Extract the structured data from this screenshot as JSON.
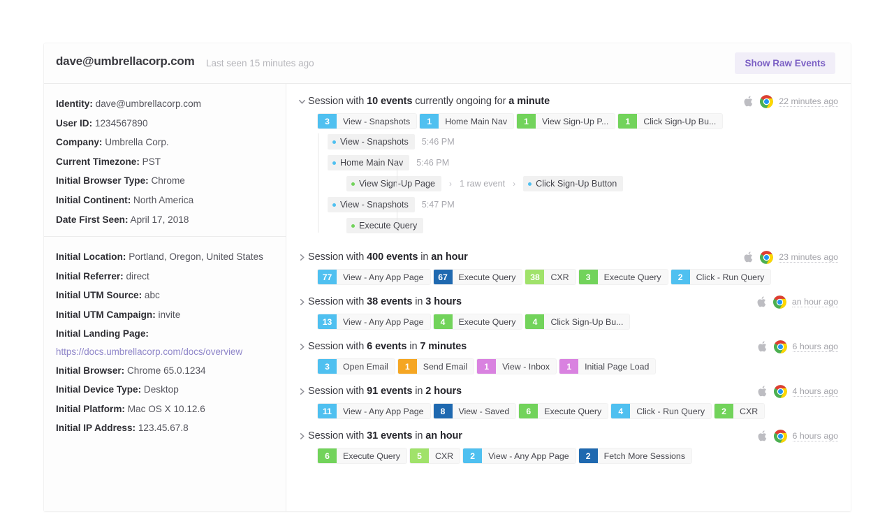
{
  "header": {
    "email": "dave@umbrellacorp.com",
    "last_seen": "Last seen 15 minutes ago",
    "raw_events_button": "Show Raw Events"
  },
  "colors": {
    "accent_purple": "#7b5fc4",
    "button_bg": "#f1eef8",
    "blue_light": "#4fc0f0",
    "blue_dark": "#1f69b0",
    "green_light": "#a0e26a",
    "green": "#72d35b",
    "orange": "#f5a623",
    "pink": "#d982e0",
    "link": "#8f86c9"
  },
  "sidebar": {
    "group_one": [
      {
        "label": "Identity:",
        "value": "dave@umbrellacorp.com"
      },
      {
        "label": "User ID:",
        "value": "1234567890"
      },
      {
        "label": "Company:",
        "value": "Umbrella Corp."
      },
      {
        "label": "Current Timezone:",
        "value": "PST"
      },
      {
        "label": "Initial Browser Type:",
        "value": "Chrome"
      },
      {
        "label": "Initial Continent:",
        "value": "North America"
      },
      {
        "label": "Date First Seen:",
        "value": "April 17, 2018"
      }
    ],
    "group_two": [
      {
        "label": "Initial Location:",
        "value": "Portland, Oregon, United States"
      },
      {
        "label": "Initial Referrer:",
        "value": "direct"
      },
      {
        "label": "Initial UTM Source:",
        "value": "abc"
      },
      {
        "label": "Initial UTM Campaign:",
        "value": "invite"
      }
    ],
    "landing_page": {
      "label": "Initial Landing Page:",
      "url": "https://docs.umbrellacorp.com/docs/overview"
    },
    "group_three": [
      {
        "label": "Initial Browser:",
        "value": "Chrome 65.0.1234"
      },
      {
        "label": "Initial Device Type:",
        "value": "Desktop"
      },
      {
        "label": "Initial Platform:",
        "value": "Mac OS X 10.12.6"
      },
      {
        "label": "Initial IP Address:",
        "value": "123.45.67.8"
      }
    ]
  },
  "sessions": [
    {
      "expanded": true,
      "title_prefix": "Session with ",
      "count": "10 events",
      "title_mid": " currently ongoing for ",
      "duration": "a minute",
      "platform_icon": "apple-icon",
      "browser_icon": "chrome-icon",
      "time": "22 minutes ago",
      "chips": [
        {
          "num": "3",
          "label": "View - Snapshots",
          "color": "#4fc0f0"
        },
        {
          "num": "1",
          "label": "Home Main Nav",
          "color": "#4fc0f0"
        },
        {
          "num": "1",
          "label": "View Sign-Up P...",
          "color": "#72d35b"
        },
        {
          "num": "1",
          "label": "Click Sign-Up Bu...",
          "color": "#72d35b"
        }
      ],
      "events": [
        {
          "level": 1,
          "label": "View - Snapshots",
          "dot": "#4fc0f0",
          "time": "5:46 PM"
        },
        {
          "level": 1,
          "label": "Home Main Nav",
          "dot": "#4fc0f0",
          "time": "5:46 PM"
        },
        {
          "level": 2,
          "label": "View Sign-Up Page",
          "dot": "#72d35b",
          "raw_label": "1 raw event",
          "next_label": "Click Sign-Up Button",
          "next_dot": "#4fc0f0"
        },
        {
          "level": 1,
          "label": "View - Snapshots",
          "dot": "#4fc0f0",
          "time": "5:47 PM"
        },
        {
          "level": 2,
          "label": "Execute Query",
          "dot": "#72d35b"
        }
      ]
    },
    {
      "expanded": false,
      "title_prefix": "Session with ",
      "count": "400 events",
      "title_mid": " in ",
      "duration": "an hour",
      "platform_icon": "apple-icon",
      "browser_icon": "chrome-icon",
      "time": "23 minutes ago",
      "chips": [
        {
          "num": "77",
          "label": "View - Any App Page",
          "color": "#4fc0f0"
        },
        {
          "num": "67",
          "label": "Execute Query",
          "color": "#1f69b0"
        },
        {
          "num": "38",
          "label": "CXR",
          "color": "#a0e26a"
        },
        {
          "num": "3",
          "label": "Execute Query",
          "color": "#72d35b"
        },
        {
          "num": "2",
          "label": "Click - Run Query",
          "color": "#4fc0f0"
        }
      ],
      "events": []
    },
    {
      "expanded": false,
      "title_prefix": "Session with ",
      "count": "38 events",
      "title_mid": " in ",
      "duration": "3 hours",
      "platform_icon": "apple-icon",
      "browser_icon": "chrome-icon",
      "time": "an hour ago",
      "chips": [
        {
          "num": "13",
          "label": "View - Any App Page",
          "color": "#4fc0f0"
        },
        {
          "num": "4",
          "label": "Execute Query",
          "color": "#72d35b"
        },
        {
          "num": "4",
          "label": "Click Sign-Up Bu...",
          "color": "#72d35b"
        }
      ],
      "events": []
    },
    {
      "expanded": false,
      "title_prefix": "Session with ",
      "count": "6 events",
      "title_mid": " in ",
      "duration": "7 minutes",
      "platform_icon": "apple-icon",
      "browser_icon": "chrome-icon",
      "time": "6 hours ago",
      "chips": [
        {
          "num": "3",
          "label": "Open Email",
          "color": "#4fc0f0"
        },
        {
          "num": "1",
          "label": "Send Email",
          "color": "#f5a623"
        },
        {
          "num": "1",
          "label": "View - Inbox",
          "color": "#d982e0"
        },
        {
          "num": "1",
          "label": "Initial Page Load",
          "color": "#d982e0"
        }
      ],
      "events": []
    },
    {
      "expanded": false,
      "title_prefix": "Session with ",
      "count": "91 events",
      "title_mid": " in ",
      "duration": "2 hours",
      "platform_icon": "apple-icon",
      "browser_icon": "chrome-icon",
      "time": "4 hours ago",
      "chips": [
        {
          "num": "11",
          "label": "View - Any App Page",
          "color": "#4fc0f0"
        },
        {
          "num": "8",
          "label": "View - Saved",
          "color": "#1f69b0"
        },
        {
          "num": "6",
          "label": "Execute Query",
          "color": "#72d35b"
        },
        {
          "num": "4",
          "label": "Click - Run Query",
          "color": "#4fc0f0"
        },
        {
          "num": "2",
          "label": "CXR",
          "color": "#72d35b"
        }
      ],
      "events": []
    },
    {
      "expanded": false,
      "title_prefix": "Session with ",
      "count": "31 events",
      "title_mid": " in ",
      "duration": "an hour",
      "platform_icon": "apple-icon",
      "browser_icon": "chrome-icon",
      "time": "6 hours ago",
      "chips": [
        {
          "num": "6",
          "label": "Execute Query",
          "color": "#72d35b"
        },
        {
          "num": "5",
          "label": "CXR",
          "color": "#a0e26a"
        },
        {
          "num": "2",
          "label": "View - Any App Page",
          "color": "#4fc0f0"
        },
        {
          "num": "2",
          "label": "Fetch More Sessions",
          "color": "#1f69b0"
        }
      ],
      "events": []
    }
  ]
}
